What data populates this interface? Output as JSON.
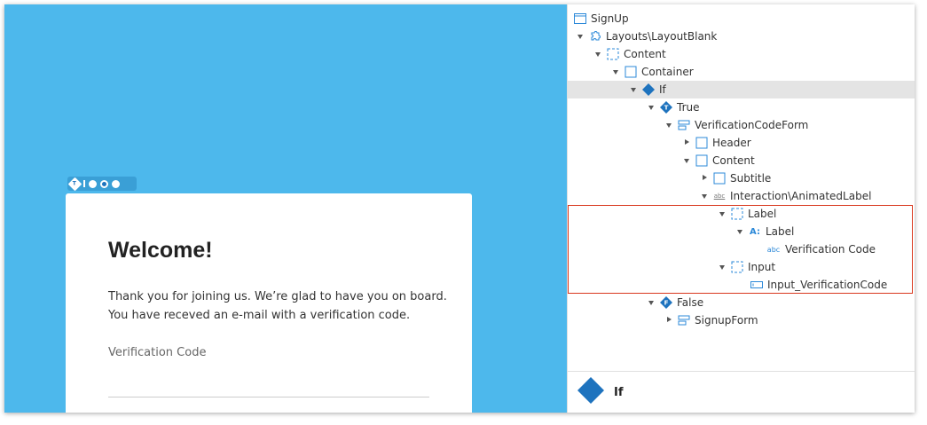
{
  "canvas": {
    "widget_badge": "T",
    "card": {
      "title": "Welcome!",
      "text_line1": "Thank you for joining us. We’re glad to have you on board.",
      "text_line2": "You have receved an e-mail with a verification code.",
      "input_label": "Verification Code"
    }
  },
  "tree": {
    "items": [
      {
        "label": "SignUp",
        "icon": "screen-icon",
        "expand": "none"
      },
      {
        "label": "Layouts\\LayoutBlank",
        "icon": "block-icon",
        "expand": "down"
      },
      {
        "label": "Content",
        "icon": "placeholder-icon",
        "expand": "down"
      },
      {
        "label": "Container",
        "icon": "container-icon",
        "expand": "down"
      },
      {
        "label": "If",
        "icon": "if-icon",
        "expand": "down",
        "selected": true
      },
      {
        "label": "True",
        "icon": "true-branch-icon",
        "expand": "down",
        "badge": "T"
      },
      {
        "label": "VerificationCodeForm",
        "icon": "form-icon",
        "expand": "down"
      },
      {
        "label": "Header",
        "icon": "container-icon",
        "expand": "right"
      },
      {
        "label": "Content",
        "icon": "container-icon",
        "expand": "down"
      },
      {
        "label": "Subtitle",
        "icon": "container-icon",
        "expand": "right"
      },
      {
        "label": "Interaction\\AnimatedLabel",
        "icon": "block-label-icon",
        "expand": "down",
        "icon_text": "abc"
      },
      {
        "label": "Label",
        "icon": "placeholder-icon",
        "expand": "down"
      },
      {
        "label": "Label",
        "icon": "label-widget-icon",
        "expand": "down",
        "icon_text": "A:"
      },
      {
        "label": "Verification Code",
        "icon": "expression-icon",
        "expand": "none",
        "icon_text": "abc"
      },
      {
        "label": "Input",
        "icon": "placeholder-icon",
        "expand": "down"
      },
      {
        "label": "Input_VerificationCode",
        "icon": "input-icon",
        "expand": "none"
      },
      {
        "label": "False",
        "icon": "false-branch-icon",
        "expand": "down",
        "badge": "F"
      },
      {
        "label": "SignupForm",
        "icon": "form-icon",
        "expand": "right"
      }
    ]
  },
  "properties": {
    "title": "If"
  },
  "colors": {
    "canvas_bg": "#4db8ec",
    "accent_blue": "#1e73be",
    "icon_blue": "#2b88d8",
    "highlight_red": "#d9381e",
    "selected_row": "#e4e4e4"
  }
}
